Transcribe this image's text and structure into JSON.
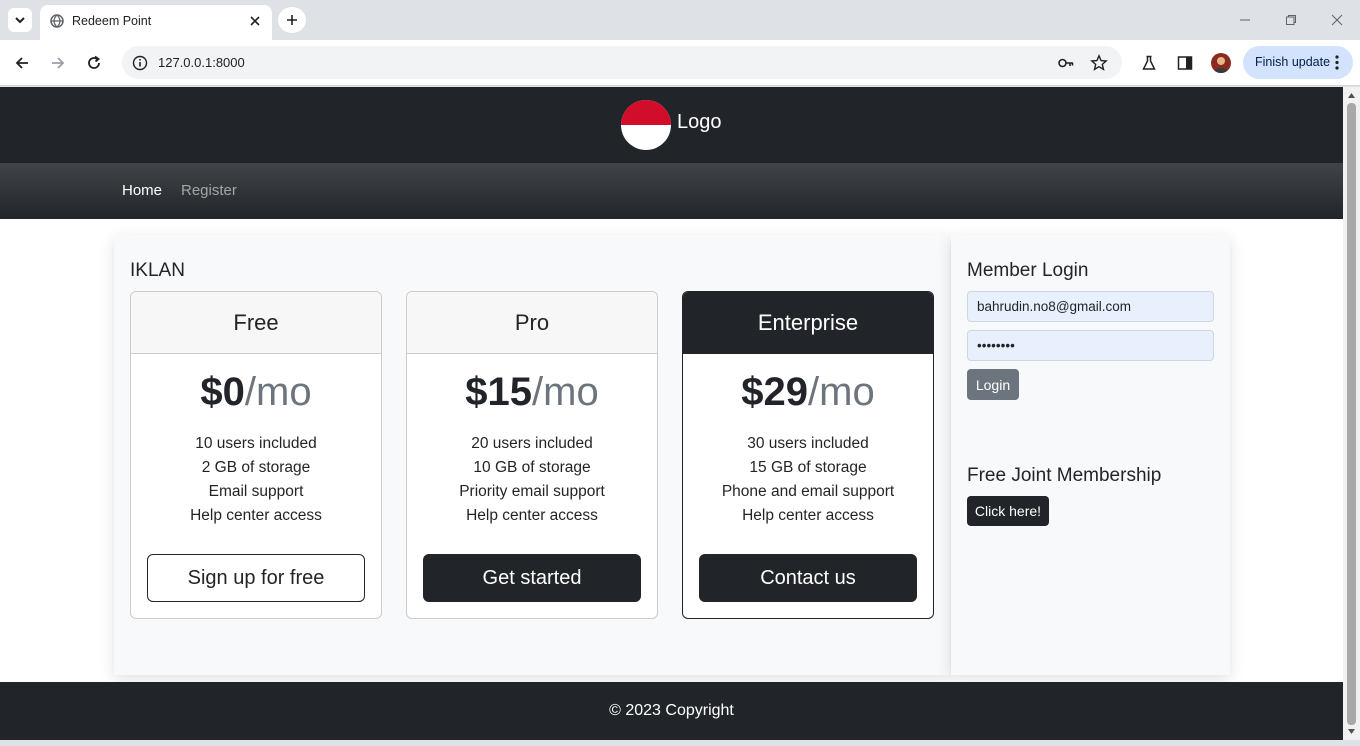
{
  "browser": {
    "tab_title": "Redeem Point",
    "url": "127.0.0.1:8000",
    "finish_update_label": "Finish update"
  },
  "site": {
    "logo_text": "Logo",
    "nav": {
      "home": "Home",
      "register": "Register"
    }
  },
  "ads": {
    "title": "IKLAN",
    "plans": [
      {
        "name": "Free",
        "price": "$0",
        "period": "/mo",
        "features": [
          "10 users included",
          "2 GB of storage",
          "Email support",
          "Help center access"
        ],
        "cta": "Sign up for free"
      },
      {
        "name": "Pro",
        "price": "$15",
        "period": "/mo",
        "features": [
          "20 users included",
          "10 GB of storage",
          "Priority email support",
          "Help center access"
        ],
        "cta": "Get started"
      },
      {
        "name": "Enterprise",
        "price": "$29",
        "period": "/mo",
        "features": [
          "30 users included",
          "15 GB of storage",
          "Phone and email support",
          "Help center access"
        ],
        "cta": "Contact us"
      }
    ]
  },
  "login": {
    "title": "Member Login",
    "email_value": "bahrudin.no8@gmail.com",
    "password_value": "••••••••",
    "login_label": "Login"
  },
  "membership": {
    "title": "Free Joint Membership",
    "button_label": "Click here!"
  },
  "footer": {
    "copyright": "© 2023 Copyright"
  },
  "icons": {
    "tab_search": "chevron-down-icon",
    "tab_close": "close-icon",
    "new_tab": "plus-icon",
    "back": "arrow-left-icon",
    "forward": "arrow-right-icon",
    "reload": "reload-icon",
    "site_info": "info-icon",
    "password_key": "key-icon",
    "bookmark": "star-icon",
    "labs": "flask-icon",
    "side_panel": "side-panel-icon",
    "menu": "kebab-menu-icon"
  },
  "colors": {
    "dark": "#212529",
    "flag_red": "#d10d2b",
    "secondary": "#6c757d",
    "finish_update_bg": "#d3e3fd"
  }
}
